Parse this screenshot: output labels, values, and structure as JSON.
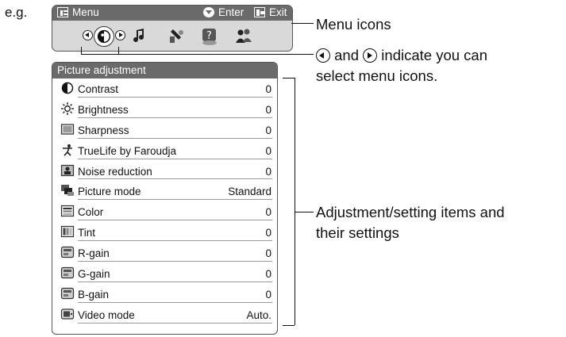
{
  "example_label": "e.g.",
  "menu_bar": {
    "title": "Menu",
    "enter_label": "Enter",
    "exit_label": "Exit"
  },
  "menu_icons": [
    {
      "name": "picture-icon",
      "selected": true
    },
    {
      "name": "sound-icon",
      "selected": false
    },
    {
      "name": "setup-icon",
      "selected": false
    },
    {
      "name": "help-icon",
      "selected": false
    },
    {
      "name": "people-icon",
      "selected": false
    }
  ],
  "callouts": {
    "menu_icons": "Menu icons",
    "nav_and": "and",
    "nav_line1_rest": "indicate you can",
    "nav_line2": "select menu icons.",
    "items_line1": "Adjustment/setting items and",
    "items_line2": "their settings"
  },
  "panel": {
    "title": "Picture adjustment",
    "items": [
      {
        "label": "Contrast",
        "value": "0",
        "icon": "contrast-icon"
      },
      {
        "label": "Brightness",
        "value": "0",
        "icon": "brightness-icon"
      },
      {
        "label": "Sharpness",
        "value": "0",
        "icon": "sharpness-icon"
      },
      {
        "label": "TrueLife by Faroudja",
        "value": "0",
        "icon": "truelife-icon"
      },
      {
        "label": "Noise reduction",
        "value": "0",
        "icon": "noise-reduction-icon"
      },
      {
        "label": "Picture mode",
        "value": "Standard",
        "icon": "picture-mode-icon"
      },
      {
        "label": "Color",
        "value": "0",
        "icon": "color-icon"
      },
      {
        "label": "Tint",
        "value": "0",
        "icon": "tint-icon"
      },
      {
        "label": "R-gain",
        "value": "0",
        "icon": "r-gain-icon"
      },
      {
        "label": "G-gain",
        "value": "0",
        "icon": "g-gain-icon"
      },
      {
        "label": "B-gain",
        "value": "0",
        "icon": "b-gain-icon"
      },
      {
        "label": "Video mode",
        "value": "Auto.",
        "icon": "video-mode-icon"
      }
    ]
  }
}
